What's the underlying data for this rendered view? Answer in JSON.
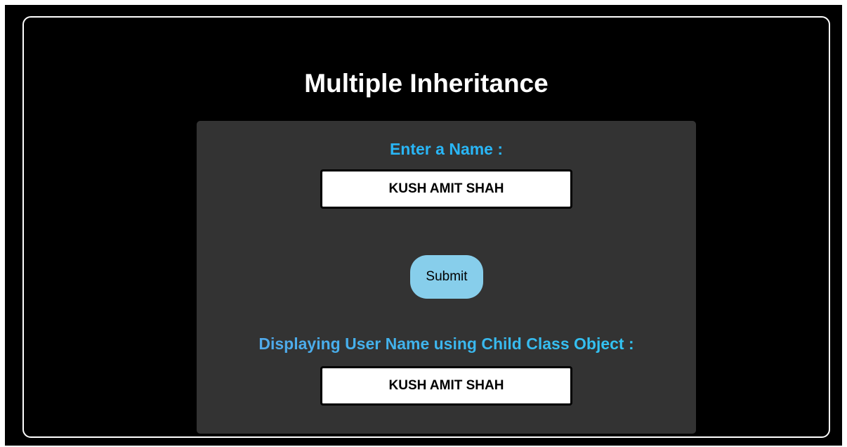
{
  "page": {
    "title": "Multiple Inheritance"
  },
  "form": {
    "name_label": "Enter a Name :",
    "name_value": "KUSH AMIT SHAH",
    "submit_label": "Submit",
    "display_label": "Displaying User Name using Child Class Object :",
    "display_value": "KUSH AMIT SHAH"
  },
  "colors": {
    "background": "#000000",
    "panel": "#333333",
    "label_accent": "#29b6f6",
    "button": "#87ceeb"
  }
}
